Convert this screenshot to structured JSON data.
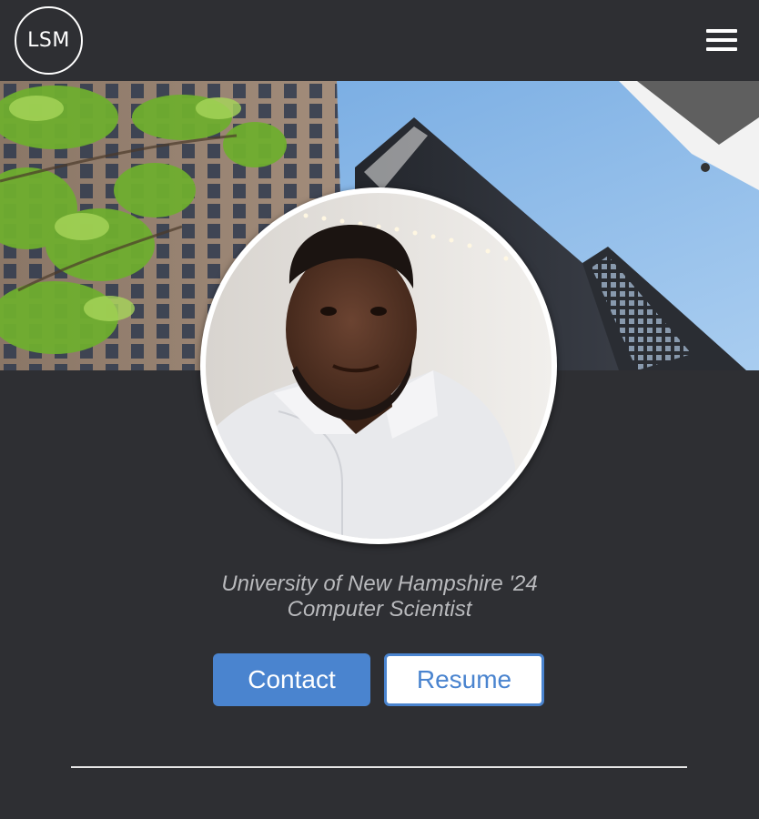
{
  "header": {
    "logo_text": "LSM",
    "menu_icon": "hamburger-menu-icon"
  },
  "banner": {
    "description_icon": "city-buildings-photo"
  },
  "profile": {
    "photo": "profile-photo"
  },
  "tagline": {
    "line1": "University of New Hampshire '24",
    "line2": "Computer Scientist"
  },
  "buttons": {
    "contact_label": "Contact",
    "resume_label": "Resume"
  },
  "colors": {
    "background": "#2e2f33",
    "accent": "#4a84cf",
    "tagline": "#b9babd"
  }
}
